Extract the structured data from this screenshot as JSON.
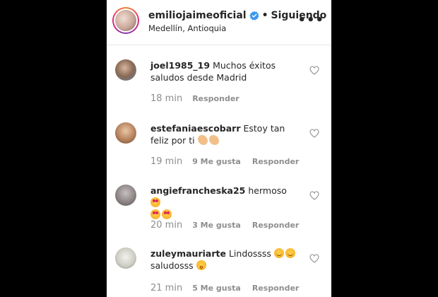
{
  "header": {
    "username": "emiliojaimeoficial",
    "separator": "•",
    "follow_status": "Siguiendo",
    "location": "Medellín, Antioquia",
    "more_icon": "more-dots-icon",
    "more_label": "•••"
  },
  "comments": [
    {
      "user": "joel1985_19",
      "text": "Muchos éxitos saludos desde Madrid",
      "time": "18 min",
      "likes": "",
      "reply": "Responder"
    },
    {
      "user": "estefaniaescobarr",
      "text": "Estoy tan feliz por ti",
      "time": "19 min",
      "likes": "9 Me gusta",
      "reply": "Responder"
    },
    {
      "user": "angiefrancheska25",
      "text": "hermoso",
      "time": "20 min",
      "likes": "3 Me gusta",
      "reply": "Responder"
    },
    {
      "user": "zuleymauriarte",
      "text": "Lindossss",
      "text2": "saludosss",
      "time": "21 min",
      "likes": "5 Me gusta",
      "reply": "Responder"
    }
  ],
  "colors": {
    "text": "#262626",
    "muted": "#8e8e8e",
    "verified": "#3897f0"
  }
}
